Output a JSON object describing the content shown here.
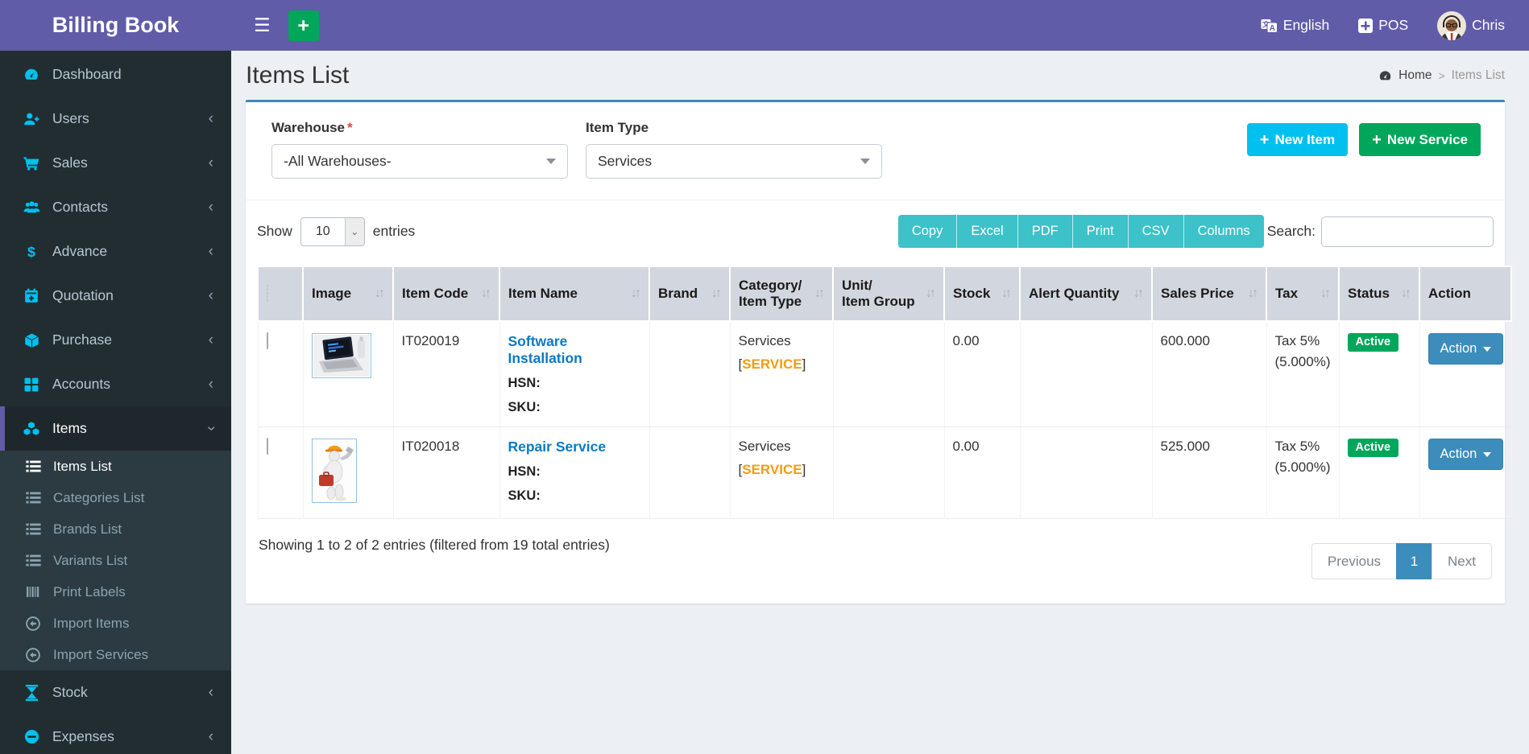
{
  "header": {
    "brand": "Billing Book",
    "language_label": "English",
    "pos_label": "POS",
    "user_name": "Chris"
  },
  "sidebar": {
    "items": [
      {
        "label": "Dashboard",
        "icon": "gauge-icon",
        "active": false,
        "expandable": false
      },
      {
        "label": "Users",
        "icon": "user-plus-icon",
        "active": false,
        "expandable": true
      },
      {
        "label": "Sales",
        "icon": "cart-icon",
        "active": false,
        "expandable": true
      },
      {
        "label": "Contacts",
        "icon": "users-icon",
        "active": false,
        "expandable": true
      },
      {
        "label": "Advance",
        "icon": "dollar-icon",
        "active": false,
        "expandable": true
      },
      {
        "label": "Quotation",
        "icon": "calendar-plus-icon",
        "active": false,
        "expandable": true
      },
      {
        "label": "Purchase",
        "icon": "cube-icon",
        "active": false,
        "expandable": true
      },
      {
        "label": "Accounts",
        "icon": "grid-icon",
        "active": false,
        "expandable": true
      },
      {
        "label": "Items",
        "icon": "cubes-icon",
        "active": true,
        "expandable": true,
        "expanded": true
      },
      {
        "label": "Stock",
        "icon": "hourglass-icon",
        "active": false,
        "expandable": true
      },
      {
        "label": "Expenses",
        "icon": "minus-circle-icon",
        "active": false,
        "expandable": true
      }
    ],
    "items_submenu": [
      {
        "label": "Items List",
        "icon": "list-icon",
        "active": true
      },
      {
        "label": "Categories List",
        "icon": "list-icon",
        "active": false
      },
      {
        "label": "Brands List",
        "icon": "list-icon",
        "active": false
      },
      {
        "label": "Variants List",
        "icon": "list-icon",
        "active": false
      },
      {
        "label": "Print Labels",
        "icon": "barcode-icon",
        "active": false
      },
      {
        "label": "Import Items",
        "icon": "import-icon",
        "active": false
      },
      {
        "label": "Import Services",
        "icon": "import-icon",
        "active": false
      }
    ]
  },
  "page": {
    "title": "Items List",
    "breadcrumb_home": "Home",
    "breadcrumb_separator": ">",
    "breadcrumb_current": "Items List"
  },
  "filters": {
    "warehouse_label": "Warehouse",
    "warehouse_required": "*",
    "warehouse_value": "-All Warehouses-",
    "item_type_label": "Item Type",
    "item_type_value": "Services"
  },
  "buttons": {
    "new_item": "New Item",
    "new_service": "New Service",
    "plus": "+"
  },
  "controls": {
    "show_label": "Show",
    "page_length": "10",
    "entries_label": "entries",
    "export": [
      "Copy",
      "Excel",
      "PDF",
      "Print",
      "CSV",
      "Columns"
    ],
    "search_label": "Search:",
    "search_value": ""
  },
  "table": {
    "columns": [
      {
        "line1": "",
        "line2": "",
        "sortable": false
      },
      {
        "line1": "Image",
        "line2": "",
        "sortable": true
      },
      {
        "line1": "Item Code",
        "line2": "",
        "sortable": true
      },
      {
        "line1": "Item Name",
        "line2": "",
        "sortable": true
      },
      {
        "line1": "Brand",
        "line2": "",
        "sortable": true
      },
      {
        "line1": "Category/",
        "line2": "Item Type",
        "sortable": true
      },
      {
        "line1": "Unit/",
        "line2": "Item Group",
        "sortable": true
      },
      {
        "line1": "Stock",
        "line2": "",
        "sortable": true
      },
      {
        "line1": "Alert Quantity",
        "line2": "",
        "sortable": true
      },
      {
        "line1": "Sales Price",
        "line2": "",
        "sortable": true
      },
      {
        "line1": "Tax",
        "line2": "",
        "sortable": true
      },
      {
        "line1": "Status",
        "line2": "",
        "sortable": true
      },
      {
        "line1": "Action",
        "line2": "",
        "sortable": false
      }
    ],
    "sort_icon": "↓↑",
    "rows": [
      {
        "image": "laptop-photo",
        "item_code": "IT020019",
        "item_name": "Software Installation",
        "hsn_label": "HSN:",
        "sku_label": "SKU:",
        "brand": "",
        "category": "Services",
        "tag_open": "[",
        "item_type_tag": "SERVICE",
        "tag_close": "]",
        "unit_item_group": "",
        "stock": "0.00",
        "alert_quantity": "",
        "sales_price": "600.000",
        "tax_name": "Tax 5%",
        "tax_rate": "(5.000%)",
        "status": "Active",
        "action_label": "Action"
      },
      {
        "image": "repair-figure",
        "item_code": "IT020018",
        "item_name": "Repair Service",
        "hsn_label": "HSN:",
        "sku_label": "SKU:",
        "brand": "",
        "category": "Services",
        "tag_open": "[",
        "item_type_tag": "SERVICE",
        "tag_close": "]",
        "unit_item_group": "",
        "stock": "0.00",
        "alert_quantity": "",
        "sales_price": "525.000",
        "tax_name": "Tax 5%",
        "tax_rate": "(5.000%)",
        "status": "Active",
        "action_label": "Action"
      }
    ]
  },
  "footer": {
    "summary": "Showing 1 to 2 of 2 entries (filtered from 19 total entries)",
    "previous_label": "Previous",
    "page_label": "1",
    "next_label": "Next"
  },
  "colors": {
    "header_purple": "#605ca8",
    "sidebar_dark": "#222d32",
    "icon_cyan": "#00c0ef",
    "green": "#00a65a",
    "export_teal": "#3cc2c8",
    "link_blue": "#0a7ac2",
    "tag_orange": "#f39c12",
    "action_blue": "#3c8dbc",
    "card_top_border": "#3c8dbc"
  }
}
